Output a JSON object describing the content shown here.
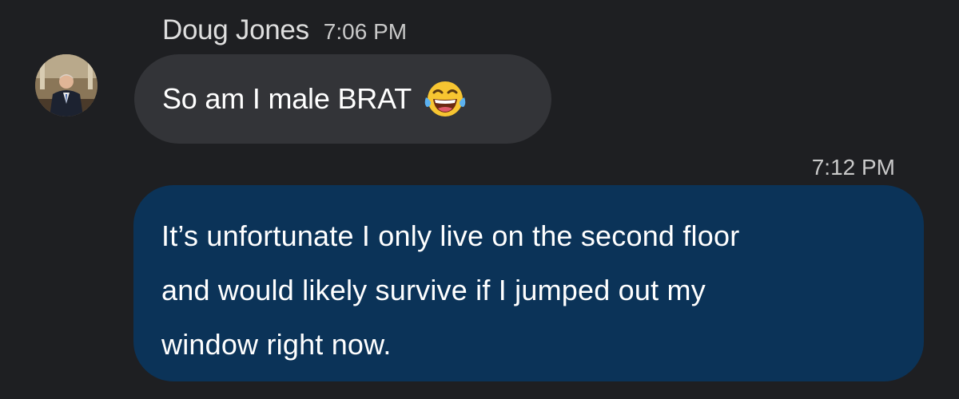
{
  "incoming": {
    "sender_name": "Doug Jones",
    "time": "7:06 PM",
    "avatar_icon": "profile-photo",
    "text": "So am I male BRAT",
    "emoji_icon": "face-with-tears-of-joy-emoji",
    "bubble_color": "#333438"
  },
  "outgoing": {
    "time": "7:12 PM",
    "lines": [
      "It’s unfortunate I only live on the second floor",
      "and would likely survive if I jumped out my",
      "window right now."
    ],
    "bubble_color": "#0b3358"
  },
  "colors": {
    "background": "#1e1f22",
    "text": "#ffffff",
    "meta_text": "#c9c9c9"
  }
}
